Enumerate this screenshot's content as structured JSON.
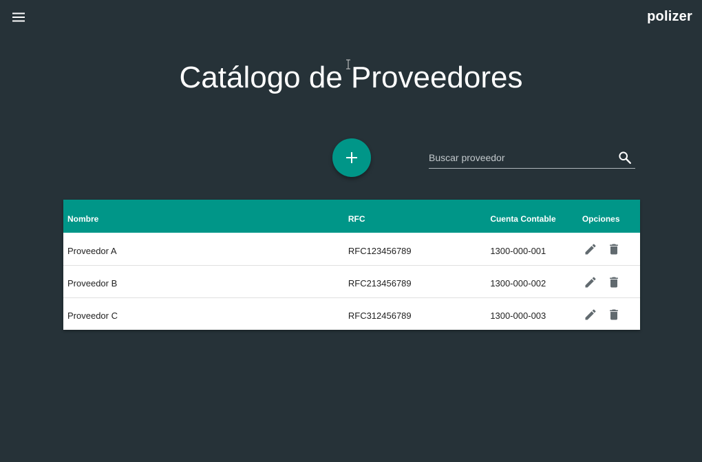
{
  "app": {
    "brand": "polizer",
    "menu_icon": "hamburger-menu-icon"
  },
  "page": {
    "title": "Catálogo de Proveedores"
  },
  "toolbar": {
    "add_icon": "plus-icon",
    "search_placeholder": "Buscar proveedor",
    "search_value": "",
    "search_icon": "search-icon"
  },
  "table": {
    "headers": {
      "nombre": "Nombre",
      "rfc": "RFC",
      "cuenta": "Cuenta Contable",
      "opciones": "Opciones"
    },
    "rows": [
      {
        "nombre": "Proveedor A",
        "rfc": "RFC123456789",
        "cuenta": "1300-000-001"
      },
      {
        "nombre": "Proveedor B",
        "rfc": "RFC213456789",
        "cuenta": "1300-000-002"
      },
      {
        "nombre": "Proveedor C",
        "rfc": "RFC312456789",
        "cuenta": "1300-000-003"
      }
    ],
    "edit_icon": "pencil-edit-icon",
    "delete_icon": "trash-delete-icon"
  },
  "colors": {
    "background": "#263238",
    "accent": "#009688",
    "icon_gray": "#616a6f"
  }
}
